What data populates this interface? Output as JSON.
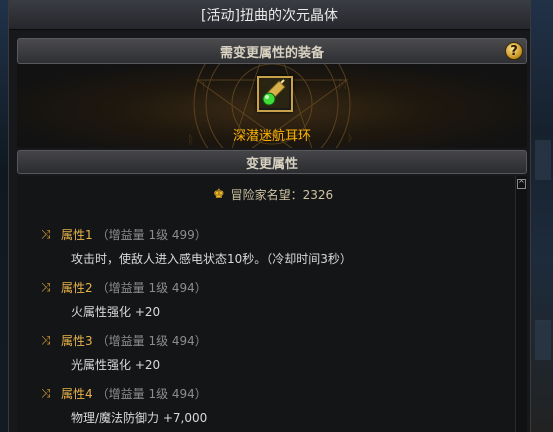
{
  "window": {
    "title": "[活动]扭曲的次元晶体"
  },
  "equipment": {
    "section_title": "需变更属性的装备",
    "help_label": "?",
    "item_name": "深潜迷航耳环"
  },
  "attributes_section": {
    "title": "变更属性",
    "fame_label": "冒险家名望：2326",
    "scroll_up": "^",
    "items": [
      {
        "name": "属性1",
        "meta": "（增益量 1级 499）",
        "desc": "攻击时，使敌人进入感电状态10秒。（冷却时间3秒）"
      },
      {
        "name": "属性2",
        "meta": "（增益量 1级 494）",
        "desc": "火属性强化 +20"
      },
      {
        "name": "属性3",
        "meta": "（增益量 1级 494）",
        "desc": "光属性强化 +20"
      },
      {
        "name": "属性4",
        "meta": "（增益量 1级 494）",
        "desc": "物理/魔法防御力 +7,000"
      }
    ]
  },
  "colors": {
    "accent_gold": "#ffb300",
    "attr_title": "#e7b24a",
    "meta_gray": "#8d8d8d",
    "text": "#d9d9d9"
  },
  "icons": {
    "help": "question-icon",
    "fame": "crown-icon",
    "attribute": "shuffle-icon",
    "item": "earring-icon"
  }
}
